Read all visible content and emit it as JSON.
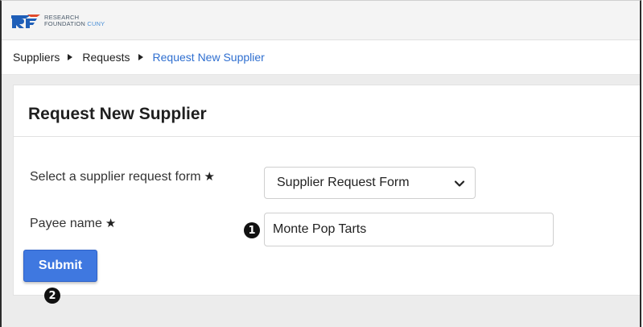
{
  "logo": {
    "line1": "RESEARCH",
    "line2": "FOUNDATION",
    "line3": "CUNY",
    "mark_color": "#1f5fb8",
    "mark_accent_color": "#e24a2b"
  },
  "breadcrumb": {
    "items": [
      "Suppliers",
      "Requests"
    ],
    "current": "Request New Supplier"
  },
  "page": {
    "title": "Request New Supplier"
  },
  "form": {
    "select_label": "Select a supplier request form",
    "select_value": "Supplier Request Form",
    "payee_label": "Payee name",
    "payee_value": "Monte Pop Tarts",
    "required_marker": "★",
    "submit_label": "Submit"
  },
  "callouts": {
    "one": "1",
    "two": "2"
  },
  "colors": {
    "accent": "#3f78e0",
    "link": "#2f6fd0"
  }
}
